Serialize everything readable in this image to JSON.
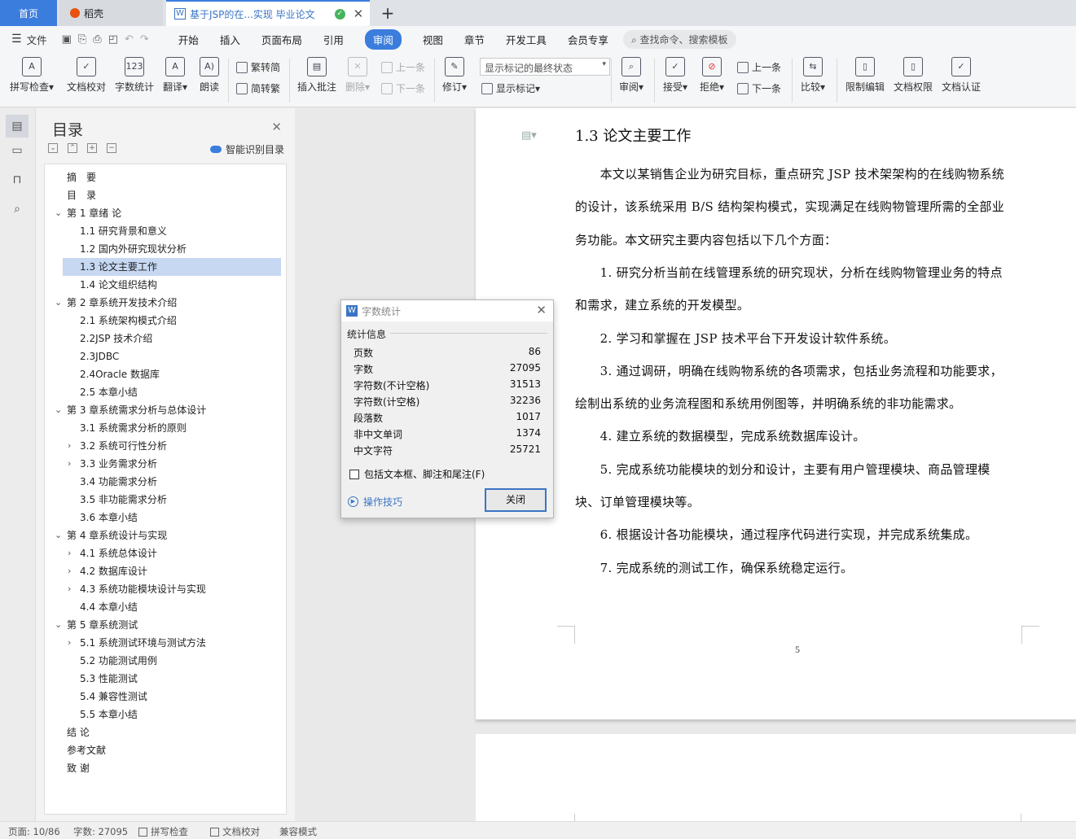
{
  "tabs": {
    "home": "首页",
    "daoke": "稻壳",
    "doc": "基于JSP的在...实现 毕业论文",
    "close": "✕",
    "add": "+"
  },
  "menu": {
    "file": "文件",
    "items": [
      "开始",
      "插入",
      "页面布局",
      "引用",
      "审阅",
      "视图",
      "章节",
      "开发工具",
      "会员专享"
    ],
    "search": "查找命令、搜索模板"
  },
  "ribbon": {
    "spell": "拼写检查",
    "proof": "文档校对",
    "count": "字数统计",
    "translate": "翻译",
    "read": "朗读",
    "to_trad": "繁转简",
    "to_simp": "简转繁",
    "insert_comment": "插入批注",
    "delete": "删除",
    "prev_comment": "上一条",
    "next_comment": "下一条",
    "track": "修订",
    "markup_state": "显示标记的最终状态",
    "show_markup": "显示标记",
    "review": "审阅",
    "accept": "接受",
    "reject": "拒绝",
    "prev": "上一条",
    "next": "下一条",
    "compare": "比较",
    "restrict": "限制编辑",
    "permission": "文档权限",
    "certify": "文档认证"
  },
  "nav": {
    "title": "目录",
    "smart": "智能识别目录",
    "toc": [
      {
        "text": "摘　要",
        "level": 0,
        "caret": ""
      },
      {
        "text": "目　录",
        "level": 0,
        "caret": ""
      },
      {
        "text": "第 1 章绪  论",
        "level": 0,
        "caret": "down"
      },
      {
        "text": "1.1 研究背景和意义",
        "level": 1,
        "caret": ""
      },
      {
        "text": "1.2 国内外研究现状分析",
        "level": 1,
        "caret": ""
      },
      {
        "text": "1.3 论文主要工作",
        "level": 1,
        "caret": "",
        "selected": true
      },
      {
        "text": "1.4 论文组织结构",
        "level": 1,
        "caret": ""
      },
      {
        "text": "第 2 章系统开发技术介绍",
        "level": 0,
        "caret": "down"
      },
      {
        "text": "2.1 系统架构模式介绍",
        "level": 1,
        "caret": ""
      },
      {
        "text": "2.2JSP 技术介绍",
        "level": 1,
        "caret": ""
      },
      {
        "text": "2.3JDBC",
        "level": 1,
        "caret": ""
      },
      {
        "text": "2.4Oracle 数据库",
        "level": 1,
        "caret": ""
      },
      {
        "text": "2.5 本章小结",
        "level": 1,
        "caret": ""
      },
      {
        "text": "第 3 章系统需求分析与总体设计",
        "level": 0,
        "caret": "down"
      },
      {
        "text": "3.1 系统需求分析的原则",
        "level": 1,
        "caret": ""
      },
      {
        "text": "3.2 系统可行性分析",
        "level": 1,
        "caret": "right"
      },
      {
        "text": "3.3 业务需求分析",
        "level": 1,
        "caret": "right"
      },
      {
        "text": "3.4 功能需求分析",
        "level": 1,
        "caret": ""
      },
      {
        "text": "3.5 非功能需求分析",
        "level": 1,
        "caret": ""
      },
      {
        "text": "3.6 本章小结",
        "level": 1,
        "caret": ""
      },
      {
        "text": "第 4 章系统设计与实现",
        "level": 0,
        "caret": "down"
      },
      {
        "text": "4.1 系统总体设计",
        "level": 1,
        "caret": "right"
      },
      {
        "text": "4.2 数据库设计",
        "level": 1,
        "caret": "right"
      },
      {
        "text": "4.3 系统功能模块设计与实现",
        "level": 1,
        "caret": "right"
      },
      {
        "text": "4.4 本章小结",
        "level": 1,
        "caret": ""
      },
      {
        "text": "第 5 章系统测试",
        "level": 0,
        "caret": "down"
      },
      {
        "text": "5.1 系统测试环境与测试方法",
        "level": 1,
        "caret": "right"
      },
      {
        "text": "5.2 功能测试用例",
        "level": 1,
        "caret": ""
      },
      {
        "text": "5.3 性能测试",
        "level": 1,
        "caret": ""
      },
      {
        "text": "5.4 兼容性测试",
        "level": 1,
        "caret": ""
      },
      {
        "text": "5.5 本章小结",
        "level": 1,
        "caret": ""
      },
      {
        "text": "结  论",
        "level": 0,
        "caret": ""
      },
      {
        "text": "参考文献",
        "level": 0,
        "caret": ""
      },
      {
        "text": "致  谢",
        "level": 0,
        "caret": ""
      }
    ]
  },
  "doc": {
    "heading": "1.3 论文主要工作",
    "lines": [
      "　　本文以某销售企业为研究目标，重点研究 JSP 技术架架构的在线购物系统",
      "的设计，该系统采用 B/S 结构架构模式，实现满足在线购物管理所需的全部业",
      "务功能。本文研究主要内容包括以下几个方面：",
      "　　1. 研究分析当前在线管理系统的研究现状，分析在线购物管理业务的特点",
      "和需求，建立系统的开发模型。",
      "　　2. 学习和掌握在 JSP 技术平台下开发设计软件系统。",
      "　　3. 通过调研，明确在线购物系统的各项需求，包括业务流程和功能要求，",
      "绘制出系统的业务流程图和系统用例图等，并明确系统的非功能需求。",
      "　　4. 建立系统的数据模型，完成系统数据库设计。",
      "　　5. 完成系统功能模块的划分和设计，主要有用户管理模块、商品管理模",
      "块、订单管理模块等。",
      "　　6. 根据设计各功能模块，通过程序代码进行实现，并完成系统集成。",
      "　　7. 完成系统的测试工作，确保系统稳定运行。"
    ],
    "page_number": "5"
  },
  "dialog": {
    "title": "字数统计",
    "group": "统计信息",
    "stats": [
      {
        "label": "页数",
        "value": "86"
      },
      {
        "label": "字数",
        "value": "27095"
      },
      {
        "label": "字符数(不计空格)",
        "value": "31513"
      },
      {
        "label": "字符数(计空格)",
        "value": "32236"
      },
      {
        "label": "段落数",
        "value": "1017"
      },
      {
        "label": "非中文单词",
        "value": "1374"
      },
      {
        "label": "中文字符",
        "value": "25721"
      }
    ],
    "include": "包括文本框、脚注和尾注(F)",
    "tips": "操作技巧",
    "close": "关闭"
  },
  "status": {
    "page": "页面: 10/86",
    "words": "字数: 27095",
    "spell": "拼写检查",
    "proof": "文档校对",
    "compat": "兼容模式"
  },
  "colors": {
    "accent": "#3b7ddd",
    "selected": "#c6d8f2"
  }
}
